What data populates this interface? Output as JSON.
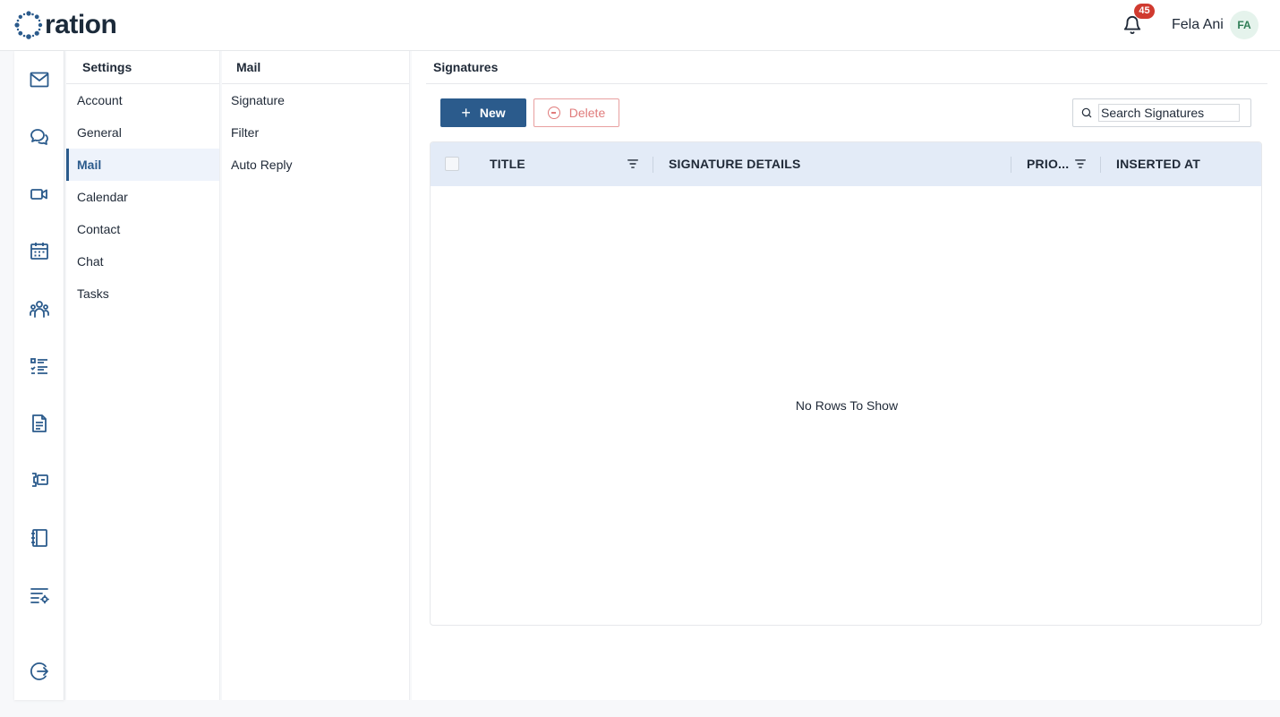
{
  "app": {
    "logo_text": "ration",
    "brand_color": "#2b5b8c"
  },
  "header": {
    "notification_count": "45",
    "user_name": "Fela Ani",
    "user_initials": "FA"
  },
  "rail": {
    "icons": [
      "mail-icon",
      "chat-icon",
      "video-icon",
      "calendar-icon",
      "contacts-icon",
      "tasks-icon",
      "document-icon",
      "board-icon",
      "notebook-icon",
      "settings-list-icon",
      "logout-icon"
    ]
  },
  "settings_menu": {
    "title": "Settings",
    "items": [
      {
        "label": "Account"
      },
      {
        "label": "General"
      },
      {
        "label": "Mail",
        "active": true
      },
      {
        "label": "Calendar"
      },
      {
        "label": "Contact"
      },
      {
        "label": "Chat"
      },
      {
        "label": "Tasks"
      }
    ]
  },
  "mail_menu": {
    "title": "Mail",
    "items": [
      {
        "label": "Signature"
      },
      {
        "label": "Filter"
      },
      {
        "label": "Auto Reply"
      }
    ]
  },
  "main": {
    "title": "Signatures",
    "new_label": "New",
    "delete_label": "Delete",
    "search_placeholder": "Search Signatures",
    "columns": [
      {
        "label": "TITLE"
      },
      {
        "label": "SIGNATURE DETAILS"
      },
      {
        "label": "PRIO..."
      },
      {
        "label": "INSERTED AT"
      }
    ],
    "empty_message": "No Rows To Show"
  }
}
